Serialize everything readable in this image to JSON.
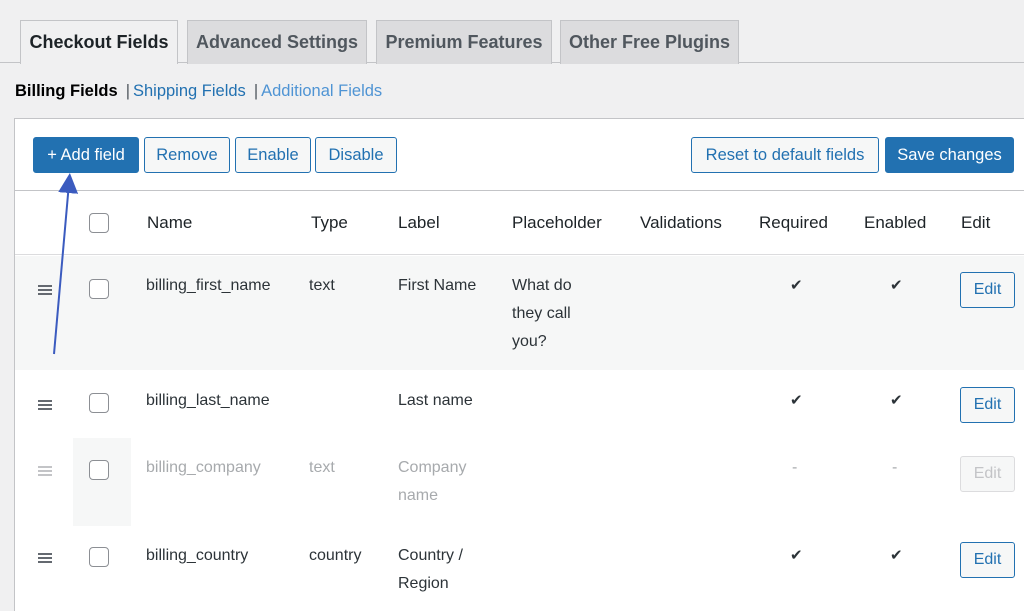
{
  "tabs": [
    {
      "label": "Checkout Fields",
      "active": true
    },
    {
      "label": "Advanced Settings",
      "active": false
    },
    {
      "label": "Premium Features",
      "active": false
    },
    {
      "label": "Other Free Plugins",
      "active": false
    }
  ],
  "subnav": {
    "current": "Billing Fields",
    "separator": "|",
    "shipping": "Shipping Fields",
    "additional": "Additional Fields"
  },
  "toolbar": {
    "add_field": "+ Add field",
    "remove": "Remove",
    "enable": "Enable",
    "disable": "Disable",
    "reset": "Reset to default fields",
    "save": "Save changes"
  },
  "table": {
    "headers": {
      "name": "Name",
      "type": "Type",
      "label": "Label",
      "placeholder": "Placeholder",
      "validations": "Validations",
      "required": "Required",
      "enabled": "Enabled",
      "edit": "Edit"
    },
    "rows": [
      {
        "name": "billing_first_name",
        "type": "text",
        "label_lines": [
          "First Name"
        ],
        "placeholder_lines": [
          "What do",
          "they call",
          "you?"
        ],
        "required": "✔",
        "enabled": "✔",
        "edit": "Edit",
        "disabled": false
      },
      {
        "name": "billing_last_name",
        "type": "",
        "label_lines": [
          "Last name"
        ],
        "placeholder_lines": [],
        "required": "✔",
        "enabled": "✔",
        "edit": "Edit",
        "disabled": false
      },
      {
        "name": "billing_company",
        "type": "text",
        "label_lines": [
          "Company",
          "name"
        ],
        "placeholder_lines": [],
        "required": "-",
        "enabled": "-",
        "edit": "Edit",
        "disabled": true
      },
      {
        "name": "billing_country",
        "type": "country",
        "label_lines": [
          "Country /",
          "Region"
        ],
        "placeholder_lines": [],
        "required": "✔",
        "enabled": "✔",
        "edit": "Edit",
        "disabled": false
      }
    ]
  },
  "icons": {
    "drag_handle": "drag-handle-icon",
    "check": "checkmark-icon"
  },
  "colors": {
    "accent": "#2271b1",
    "background": "#f0f0f1",
    "annotation_arrow": "#3b5bbf"
  }
}
